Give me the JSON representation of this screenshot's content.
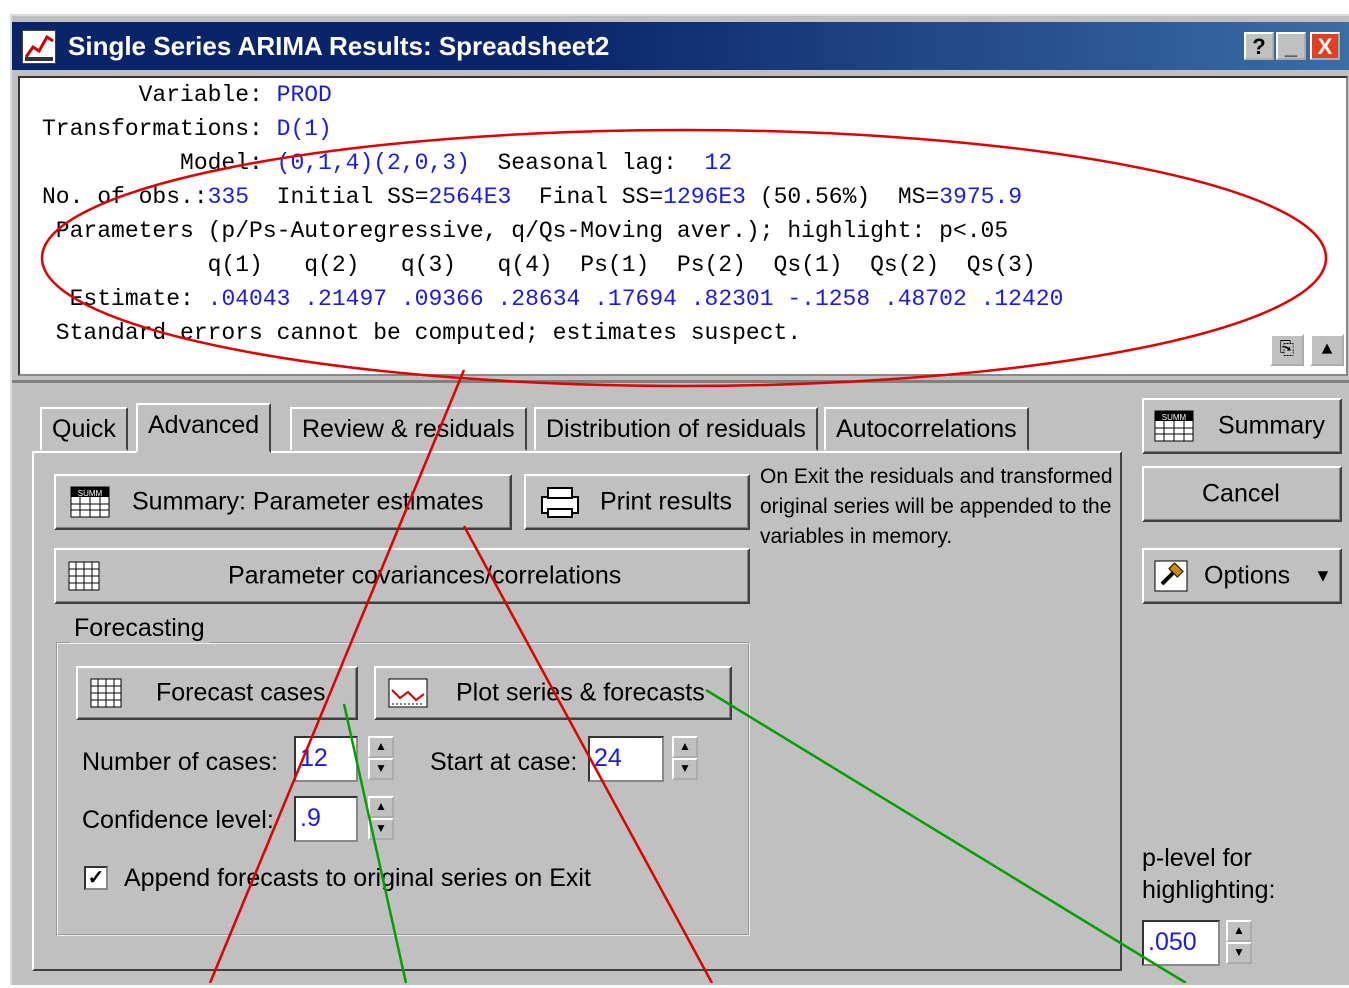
{
  "window": {
    "title": "Single Series ARIMA Results: Spreadsheet2",
    "help_btn": "?",
    "min_btn": "_",
    "close_btn": "X"
  },
  "output": {
    "l1_key": "       Variable: ",
    "l1_val": "PROD",
    "l2_key": "Transformations: ",
    "l2_val": "D(1)",
    "l3_key": "          Model: ",
    "l3_val": "(0,1,4)(2,0,3)",
    "l3_lag_key": "  Seasonal lag:  ",
    "l3_lag_val": "12",
    "l4_a": "No. of obs.:",
    "l4_a_val": "335",
    "l4_b": "  Initial SS=",
    "l4_b_val": "2564E3",
    "l4_c": "  Final SS=",
    "l4_c_val": "1296E3",
    "l4_d": " (50.56%)",
    "l4_e": "  MS=",
    "l4_e_val": "3975.9",
    "l5": " Parameters (p/Ps-Autoregressive, q/Qs-Moving aver.); highlight: p<.05",
    "l6": "            q(1)   q(2)   q(3)   q(4)  Ps(1)  Ps(2)  Qs(1)  Qs(2)  Qs(3)",
    "l7_key": "  Estimate: ",
    "l7_val": ".04043 .21497 .09366 .28634 .17694 .82301 -.1258 .48702 .12420",
    "l8": " Standard errors cannot be computed; estimates suspect."
  },
  "tabs": [
    "Quick",
    "Advanced",
    "Review & residuals",
    "Distribution of residuals",
    "Autocorrelations"
  ],
  "buttons": {
    "summary_param": "Summary:  Parameter estimates",
    "print": "Print results",
    "param_cov": "Parameter covariances/correlations",
    "forecast_cases": "Forecast cases",
    "plot_series": "Plot series & forecasts",
    "summary": "Summary",
    "cancel": "Cancel",
    "options": "Options"
  },
  "note": "On Exit the residuals and transformed original series will be appended to the variables in memory.",
  "forecasting": {
    "group_title": "Forecasting",
    "num_cases_label": "Number of cases:",
    "num_cases_val": "12",
    "start_label": "Start at case:",
    "start_val": "24",
    "conf_label": "Confidence level:",
    "conf_val": ".9",
    "append_label": "Append forecasts to original series on Exit",
    "append_checked": "✓"
  },
  "plevel": {
    "label_1": "p-level for",
    "label_2": "highlighting:",
    "value": ".050"
  },
  "icons": {
    "summary_icon": "SUMM",
    "copy_icon": "copy",
    "scroll_icon": "▲"
  },
  "colors": {
    "blue_text": "#1c1ce0",
    "annotation_red": "#e00000",
    "annotation_green": "#00a000"
  }
}
